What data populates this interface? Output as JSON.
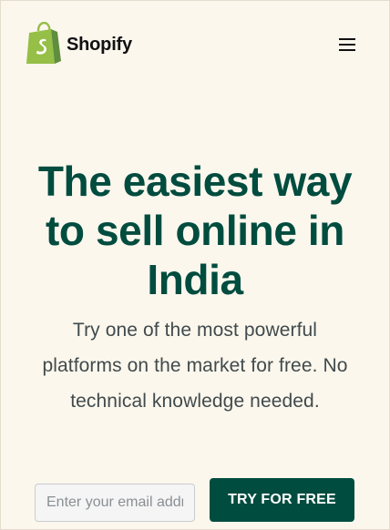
{
  "header": {
    "brand_name": "Shopify",
    "logo_icon": "shopify-bag-icon",
    "menu_icon": "hamburger-menu-icon"
  },
  "hero": {
    "headline": "The easiest way to sell online in India",
    "subtext": "Try one of the most powerful platforms on the market for free. No technical knowledge needed."
  },
  "signup": {
    "email_placeholder": "Enter your email address",
    "email_value": "",
    "cta_label": "TRY FOR FREE"
  },
  "colors": {
    "background": "#fbf7ed",
    "brand_dark_green": "#004c3f",
    "brand_light_green": "#95bf47",
    "text_gray": "#414a4c"
  }
}
